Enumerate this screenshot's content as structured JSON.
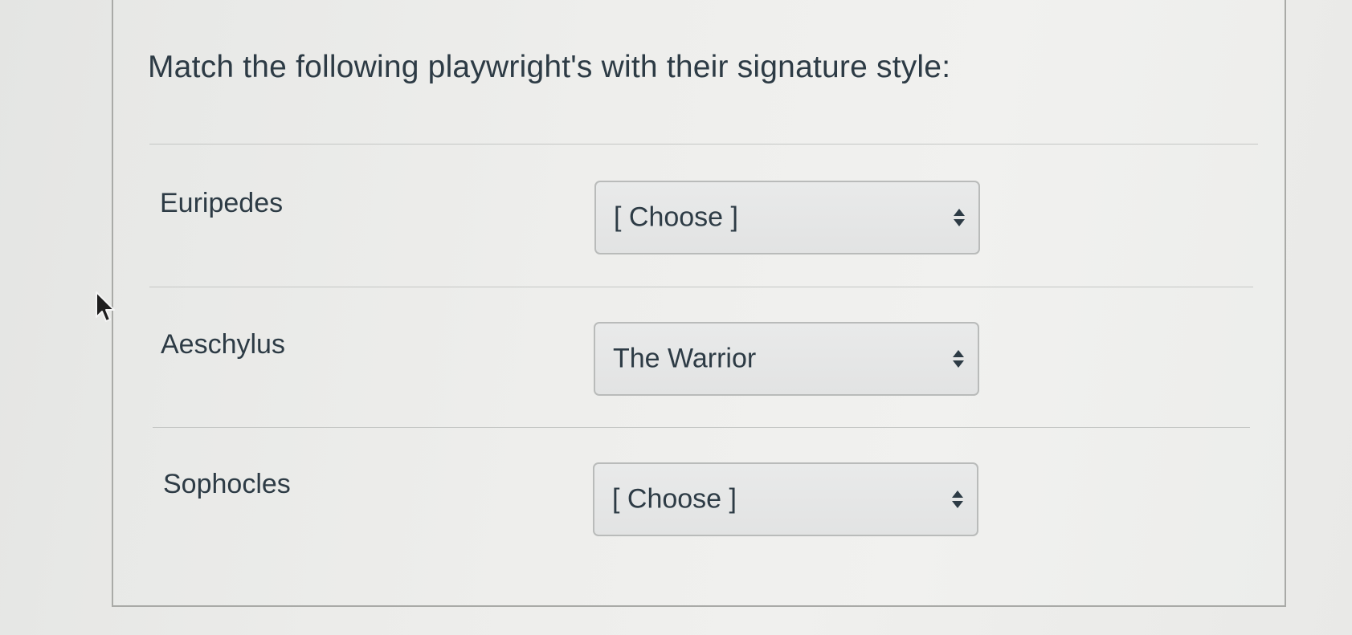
{
  "question": {
    "text": "Match the following playwright's with their signature style:"
  },
  "rows": [
    {
      "label": "Euripedes",
      "selected": "[ Choose ]"
    },
    {
      "label": "Aeschylus",
      "selected": "The Warrior"
    },
    {
      "label": "Sophocles",
      "selected": "[ Choose ]"
    }
  ],
  "icons": {
    "select_arrows": "sort-arrows-icon",
    "cursor": "mouse-pointer-icon"
  },
  "colors": {
    "text": "#2d3b45",
    "border": "#b9bbba",
    "divider": "#c5c7c5"
  }
}
